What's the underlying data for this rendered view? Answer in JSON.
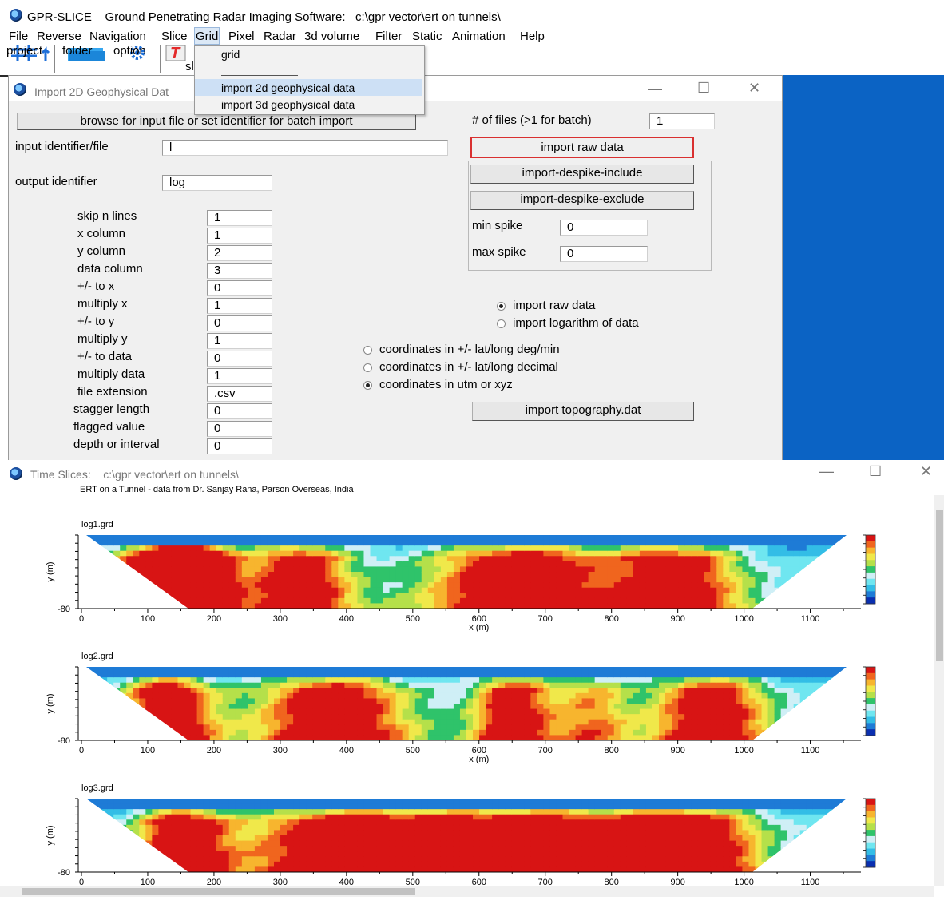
{
  "app": {
    "title": "GPR-SLICE    Ground Penetrating Radar Imaging Software:   c:\\gpr vector\\ert on tunnels\\"
  },
  "menu": [
    "File",
    "Reverse",
    "Navigation",
    "Slice",
    "Grid",
    "Pixel",
    "Radar",
    "3d volume",
    "Filter",
    "Static",
    "Animation",
    "Help"
  ],
  "toolbar": {
    "project": "project",
    "folder": "folder",
    "option": "option",
    "slice_fragment": "sl"
  },
  "dropdown": {
    "items": [
      "grid",
      "import 2d geophysical data",
      "import 3d geophysical data"
    ]
  },
  "dialog": {
    "title": "Import 2D Geophysical Dat",
    "browse_button": "browse for input file or set identifier for batch import",
    "input_label": "input identifier/file",
    "input_value": "l",
    "output_label": "output identifier",
    "output_value": "log",
    "params": [
      {
        "label": "skip n lines",
        "value": "1"
      },
      {
        "label": "x column",
        "value": "1"
      },
      {
        "label": "y column",
        "value": "2"
      },
      {
        "label": "data column",
        "value": "3"
      },
      {
        "label": "+/- to x",
        "value": "0"
      },
      {
        "label": "multiply x",
        "value": "1"
      },
      {
        "label": "+/- to y",
        "value": "0"
      },
      {
        "label": "multiply y",
        "value": "1"
      },
      {
        "label": "+/- to data",
        "value": "0"
      },
      {
        "label": "multiply data",
        "value": "1"
      },
      {
        "label": "file extension",
        "value": ".csv"
      },
      {
        "label": "stagger length",
        "value": "0"
      },
      {
        "label": "flagged value",
        "value": "0"
      },
      {
        "label": "depth or interval",
        "value": "0"
      }
    ],
    "files_label": "# of files (>1 for batch)",
    "files_value": "1",
    "import_raw_button": "import raw data",
    "despike_include_button": "import-despike-include",
    "despike_exclude_button": "import-despike-exclude",
    "min_spike_label": "min spike",
    "min_spike_value": "0",
    "max_spike_label": "max spike",
    "max_spike_value": "0",
    "data_mode": [
      {
        "label": "import raw data",
        "selected": true
      },
      {
        "label": "import logarithm of data",
        "selected": false
      }
    ],
    "coord_mode": [
      {
        "label": "coordinates in +/- lat/long deg/min",
        "selected": false
      },
      {
        "label": "coordinates in +/- lat/long decimal",
        "selected": false
      },
      {
        "label": "coordinates in utm or xyz",
        "selected": true
      }
    ],
    "topo_button": "import topography.dat"
  },
  "timeslices": {
    "title": "Time Slices:    c:\\gpr vector\\ert on tunnels\\",
    "header": "ERT on a Tunnel -  data from Dr. Sanjay Rana, Parson Overseas, India",
    "x_ticks": [
      "0",
      "100",
      "200",
      "300",
      "400",
      "500",
      "600",
      "700",
      "800",
      "900",
      "1000",
      "1100"
    ],
    "x_label": "x (m)",
    "y_label": "y (m)",
    "y_tick": "-80",
    "plots": [
      {
        "name": "log1.grd",
        "show_xlabel": true
      },
      {
        "name": "log2.grd",
        "show_xlabel": true
      },
      {
        "name": "log3.grd",
        "show_xlabel": false
      }
    ],
    "colormap": [
      "#0a2fb0",
      "#1e7bd6",
      "#33bde6",
      "#6fe6f0",
      "#cfeff6",
      "#2fc36a",
      "#b5e04a",
      "#f0e84a",
      "#f7b52e",
      "#f0651e",
      "#d81414"
    ]
  }
}
